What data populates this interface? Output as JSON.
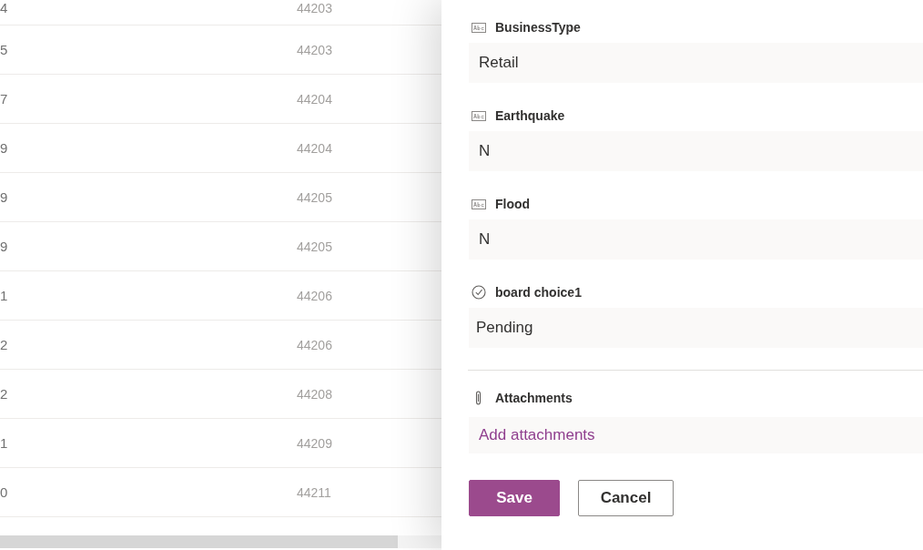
{
  "list": {
    "rows": [
      {
        "column_1": "4",
        "column_2": "44203"
      },
      {
        "column_1": "5",
        "column_2": "44203"
      },
      {
        "column_1": "7",
        "column_2": "44204"
      },
      {
        "column_1": "9",
        "column_2": "44204"
      },
      {
        "column_1": "9",
        "column_2": "44205"
      },
      {
        "column_1": "9",
        "column_2": "44205"
      },
      {
        "column_1": "1",
        "column_2": "44206"
      },
      {
        "column_1": "2",
        "column_2": "44206"
      },
      {
        "column_1": "2",
        "column_2": "44208"
      },
      {
        "column_1": "1",
        "column_2": "44209"
      },
      {
        "column_1": "0",
        "column_2": "44211"
      }
    ]
  },
  "panel": {
    "fields": [
      {
        "kind": "text",
        "label": "BusinessType",
        "value": "Retail"
      },
      {
        "kind": "text",
        "label": "Earthquake",
        "value": "N"
      },
      {
        "kind": "text",
        "label": "Flood",
        "value": "N"
      },
      {
        "kind": "choice",
        "label": "board choice1",
        "value": "Pending"
      }
    ],
    "attachments": {
      "label": "Attachments",
      "link": "Add attachments"
    },
    "buttons": [
      {
        "kind": "primary",
        "label": "Save"
      },
      {
        "kind": "secondary",
        "label": "Cancel"
      }
    ]
  }
}
